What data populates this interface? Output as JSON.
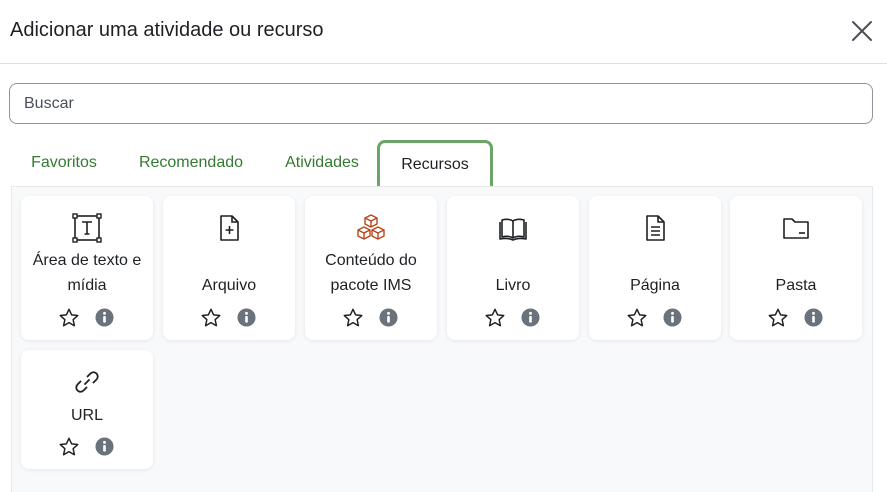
{
  "dialog": {
    "title": "Adicionar uma atividade ou recurso",
    "close_icon": "close-icon"
  },
  "search": {
    "placeholder": "Buscar",
    "value": ""
  },
  "tabs": [
    {
      "label": "Favoritos",
      "active": false
    },
    {
      "label": "Recomendado",
      "active": false
    },
    {
      "label": "Atividades",
      "active": false
    },
    {
      "label": "Recursos",
      "active": true
    }
  ],
  "colors": {
    "tab_link": "#357a32",
    "tab_active_border": "#6ba567",
    "ims_icon": "#b9461b",
    "info_icon": "#6a737b"
  },
  "resources": [
    {
      "label": "Área de texto e mídia",
      "icon": "text-frame-icon"
    },
    {
      "label": "Arquivo",
      "icon": "file-plus-icon"
    },
    {
      "label": "Conteúdo do pacote IMS",
      "icon": "cubes-icon"
    },
    {
      "label": "Livro",
      "icon": "book-icon"
    },
    {
      "label": "Página",
      "icon": "document-icon"
    },
    {
      "label": "Pasta",
      "icon": "folder-icon"
    },
    {
      "label": "URL",
      "icon": "link-icon"
    }
  ]
}
